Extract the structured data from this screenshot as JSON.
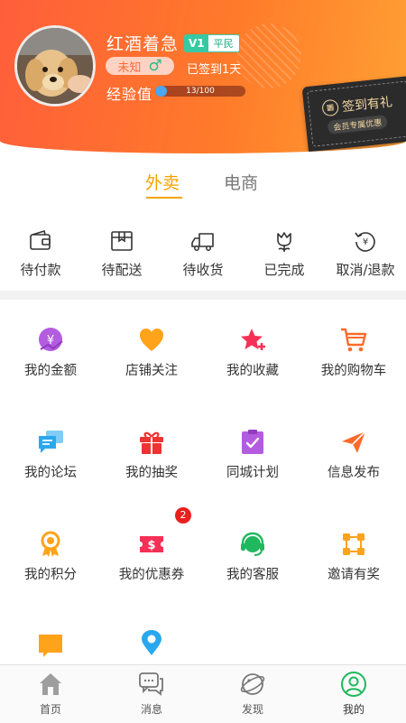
{
  "profile": {
    "username": "红酒着急",
    "vip_level": "V1",
    "vip_rank": "平民",
    "gender_text": "未知",
    "gender_symbol": "♂",
    "checkin_status": "已签到1天",
    "exp_label": "经验值",
    "exp_text": "13/100",
    "exp_progress": 0.13
  },
  "signin_card": {
    "title": "签到有礼",
    "subtitle": "会员专属优惠"
  },
  "tabs": [
    {
      "label": "外卖",
      "active": true
    },
    {
      "label": "电商",
      "active": false
    }
  ],
  "orders": [
    {
      "label": "待付款",
      "icon": "wallet-icon"
    },
    {
      "label": "待配送",
      "icon": "package-icon"
    },
    {
      "label": "待收货",
      "icon": "truck-icon"
    },
    {
      "label": "已完成",
      "icon": "flower-icon"
    },
    {
      "label": "取消/退款",
      "icon": "refund-icon"
    }
  ],
  "grid": [
    {
      "label": "我的金额",
      "icon": "money-icon",
      "color": "#b45ce0"
    },
    {
      "label": "店铺关注",
      "icon": "heart-icon",
      "color": "#ffa31a"
    },
    {
      "label": "我的收藏",
      "icon": "star-icon",
      "color": "#f53056"
    },
    {
      "label": "我的购物车",
      "icon": "cart-icon",
      "color": "#ff6a2a"
    },
    {
      "label": "我的论坛",
      "icon": "chat-icon",
      "color": "#2aa8ee"
    },
    {
      "label": "我的抽奖",
      "icon": "gift-icon",
      "color": "#ee3333"
    },
    {
      "label": "同城计划",
      "icon": "clipboard-icon",
      "color": "#b45ce0"
    },
    {
      "label": "信息发布",
      "icon": "paper-plane-icon",
      "color": "#ff6a2a"
    },
    {
      "label": "我的积分",
      "icon": "medal-icon",
      "color": "#ffa31a"
    },
    {
      "label": "我的优惠券",
      "icon": "coupon-icon",
      "color": "#f53056"
    },
    {
      "label": "我的客服",
      "icon": "headset-icon",
      "color": "#1fb85e"
    },
    {
      "label": "邀请有奖",
      "icon": "invite-icon",
      "color": "#ffa31a"
    },
    {
      "label": "",
      "icon": "message-icon",
      "color": "#ffa31a"
    },
    {
      "label": "",
      "icon": "location-icon",
      "color": "#2aa8ee"
    }
  ],
  "coupon_badge": "2",
  "bottom_nav": [
    {
      "label": "首页",
      "icon": "home-icon"
    },
    {
      "label": "消息",
      "icon": "messages-icon"
    },
    {
      "label": "发现",
      "icon": "discover-icon"
    },
    {
      "label": "我的",
      "icon": "profile-icon",
      "active": true
    }
  ],
  "colors": {
    "header_start": "#ff5e3a",
    "header_end": "#ffa033",
    "tab_active": "#f5a400",
    "nav_active": "#1fb85e"
  }
}
